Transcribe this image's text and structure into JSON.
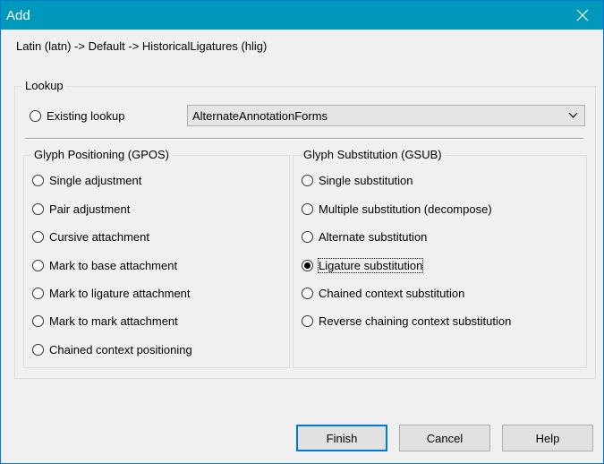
{
  "window": {
    "title": "Add"
  },
  "path": "Latin (latn) -> Default -> HistoricalLigatures (hlig)",
  "lookup": {
    "legend": "Lookup",
    "existing_label": "Existing lookup",
    "existing_selected": false,
    "select_value": "AlternateAnnotationForms"
  },
  "gpos": {
    "legend": "Glyph Positioning (GPOS)",
    "items": [
      {
        "label": "Single adjustment",
        "checked": false
      },
      {
        "label": "Pair adjustment",
        "checked": false
      },
      {
        "label": "Cursive attachment",
        "checked": false
      },
      {
        "label": "Mark to base attachment",
        "checked": false
      },
      {
        "label": "Mark to ligature attachment",
        "checked": false
      },
      {
        "label": "Mark to mark attachment",
        "checked": false
      },
      {
        "label": "Chained context positioning",
        "checked": false
      }
    ]
  },
  "gsub": {
    "legend": "Glyph Substitution (GSUB)",
    "items": [
      {
        "label": "Single substitution",
        "checked": false
      },
      {
        "label": "Multiple substitution (decompose)",
        "checked": false
      },
      {
        "label": "Alternate substitution",
        "checked": false
      },
      {
        "label": "Ligature substitution",
        "checked": true
      },
      {
        "label": "Chained context substitution",
        "checked": false
      },
      {
        "label": "Reverse chaining context substitution",
        "checked": false
      }
    ]
  },
  "buttons": {
    "finish": "Finish",
    "cancel": "Cancel",
    "help": "Help"
  },
  "colors": {
    "titlebar": "#0099bc",
    "default_button_border": "#0078d7"
  },
  "icons": {
    "close": "close-icon",
    "dropdown": "chevron-down-icon"
  }
}
